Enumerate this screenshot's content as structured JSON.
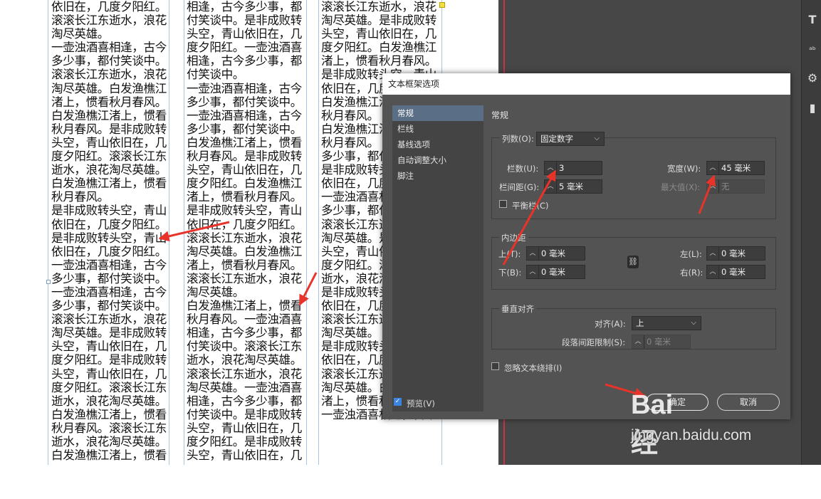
{
  "document": {
    "columns": [
      [
        "依旧在，几度夕阳红。",
        "滚滚长江东逝水，浪花淘尽英雄。",
        "一壶浊酒喜相逢，古今多少事，都付笑谈中。",
        "滚滚长江东逝水，浪花淘尽英雄。白发渔樵江渚上，惯看秋月春风。",
        "白发渔樵江渚上，惯看秋月春风。是非成败转头空，青山依旧在，几度夕阳红。滚滚长江东逝水，浪花淘尽英雄。白发渔樵江渚上，惯看秋月春风。",
        "是非成败转头空，青山依旧在，几度夕阳红。",
        "是非成败转头空，青山依旧在，几度夕阳红。",
        "一壶浊酒喜相逢，古今多少事，都付笑谈中。",
        "一壶浊酒喜相逢，古今多少事，都付笑谈中。",
        "滚滚长江东逝水，浪花淘尽英雄。是非成败转头空，青山依旧在，几度夕阳红。是非成败转头空，青山依旧在，几度夕阳红。滚滚长江东逝水，浪花淘尽英雄。白发渔樵江渚上，惯看秋月春风。滚滚长江东逝水，浪花淘尽英雄。白发渔樵江渚上，惯看"
      ],
      [
        "相逢，古今多少事，都付笑谈中。是非成败转头空，青山依旧在，几度夕阳红。一壶浊酒喜相逢，古今多少事，都付笑谈中。",
        "一壶浊酒喜相逢，古今多少事，都付笑谈中。",
        "一壶浊酒喜相逢，古今多少事，都付笑谈中。",
        "白发渔樵江渚上，惯看秋月春风。是非成败转头空，青山依旧在，几度夕阳红。白发渔樵江渚上，惯看秋月春风。",
        "是非成败转头空，青山依旧在，几度夕阳红。",
        "滚滚长江东逝水，浪花淘尽英雄。白发渔樵江渚上，惯看秋月春风。",
        "滚滚长江东逝水，浪花淘尽英雄。",
        "白发渔樵江渚上，惯看秋月春风。一壶浊酒喜相逢，古今多少事，都付笑谈中。滚滚长江东逝水，浪花淘尽英雄。",
        "滚滚长江东逝水，浪花淘尽英雄。一壶浊酒喜相逢，古今多少事，都付笑谈中。是非成败转头空，青山依旧在，几度夕阳红。是非成败转头空，青山依旧在，几"
      ],
      [
        "滚滚长江东逝水，浪花淘尽英雄。是非成败转头空，青山依旧在，几度夕阳红。白发渔樵江渚上，惯看秋月春风。",
        "是非成败转头空，青山依旧在，几度夕阳红。",
        "白发渔樵江渚上，惯看秋月春风。",
        "白发渔樵江渚上，惯看秋月春风。",
        "多少事，都付笑谈中。",
        "是非成败转头空，青山依旧在，几度夕阳红。",
        "一壶浊酒喜相逢，古今多少事，都付笑谈中。",
        "滚滚长江东逝水，浪花淘尽英雄。是非成败转头空，青山依旧在，几度夕阳红。滚滚长江东逝水，浪花淘尽英雄。是非成败转头空，青山依旧在，几度夕阳红。滚滚长江东逝水，浪花淘尽英雄。",
        "是非成败转头空，青山依旧在，几度夕阳红。",
        "滚滚长江东逝水，浪花淘尽英雄。白发渔樵江渚上，惯看秋月春风。",
        "一壶浊酒喜相逢，古今"
      ]
    ]
  },
  "panel_icons": [
    "text-icon",
    "text-wrap-icon",
    "gear-icon",
    "bookmark-icon"
  ],
  "panel_glyphs": {
    "text": "T",
    "wrap": "ᵃᵇ",
    "gear": "⚙",
    "bookmark": "▮"
  },
  "dialog": {
    "title": "文本框架选项",
    "nav": [
      "常规",
      "栏线",
      "基线选项",
      "自动调整大小",
      "脚注"
    ],
    "section": "常规",
    "columns_group": {
      "dropdown_label": "列数(O):",
      "dropdown_value": "固定数字",
      "count_label": "栏数(U):",
      "count_value": "3",
      "gutter_label": "栏间距(G):",
      "gutter_value": "5 毫米",
      "width_label": "宽度(W):",
      "width_value": "45 毫米",
      "max_label": "最大值(X):",
      "max_value": "无",
      "balance_label": "平衡栏(C)"
    },
    "inset_group": {
      "label": "内边距",
      "top_label": "上(T):",
      "top_value": "0 毫米",
      "bottom_label": "下(B):",
      "bottom_value": "0 毫米",
      "left_label": "左(L):",
      "left_value": "0 毫米",
      "right_label": "右(R):",
      "right_value": "0 毫米"
    },
    "valign_group": {
      "label": "垂直对齐",
      "align_label": "对齐(A):",
      "align_value": "上",
      "spacing_label": "段落间距限制(S):",
      "spacing_value": "0 毫米"
    },
    "ignore_wrap_label": "忽略文本绕排(I)",
    "preview_label": "预览(V)",
    "ok_label": "确定",
    "cancel_label": "取消"
  },
  "annotation_color": "#e8332a",
  "watermark": {
    "logo": "Bai 经验",
    "url": "jingyan.baidu.com"
  }
}
